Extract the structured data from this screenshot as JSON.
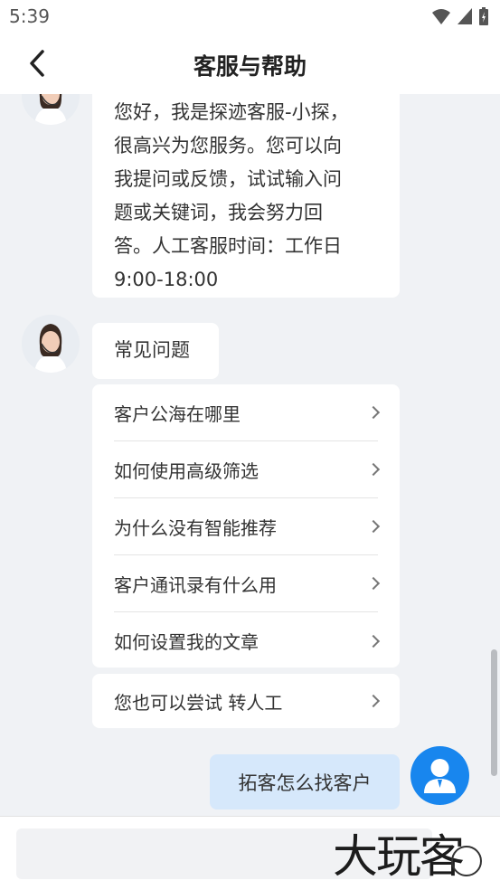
{
  "status_bar": {
    "time": "5:39"
  },
  "header": {
    "title": "客服与帮助"
  },
  "greeting": {
    "lines": [
      "您好，我是探迹客服-小探，",
      "很高兴为您服务。您可以向",
      "我提问或反馈，试试输入问",
      "题或关键词，我会努力回",
      "答。人工客服时间：工作日",
      "9:00-18:00"
    ]
  },
  "faq": {
    "title": "常见问题",
    "items": [
      "客户公海在哪里",
      "如何使用高级筛选",
      "为什么没有智能推荐",
      "客户通讯录有什么用",
      "如何设置我的文章"
    ]
  },
  "transfer": {
    "label": "您也可以尝试 转人工"
  },
  "user_message": {
    "text": "拓客怎么找客户"
  },
  "input": {
    "value": ""
  },
  "watermark": {
    "text": "大玩客"
  },
  "colors": {
    "accent": "#1886ee",
    "user_bubble": "#d6e8fb",
    "background": "#f0f2f5"
  }
}
